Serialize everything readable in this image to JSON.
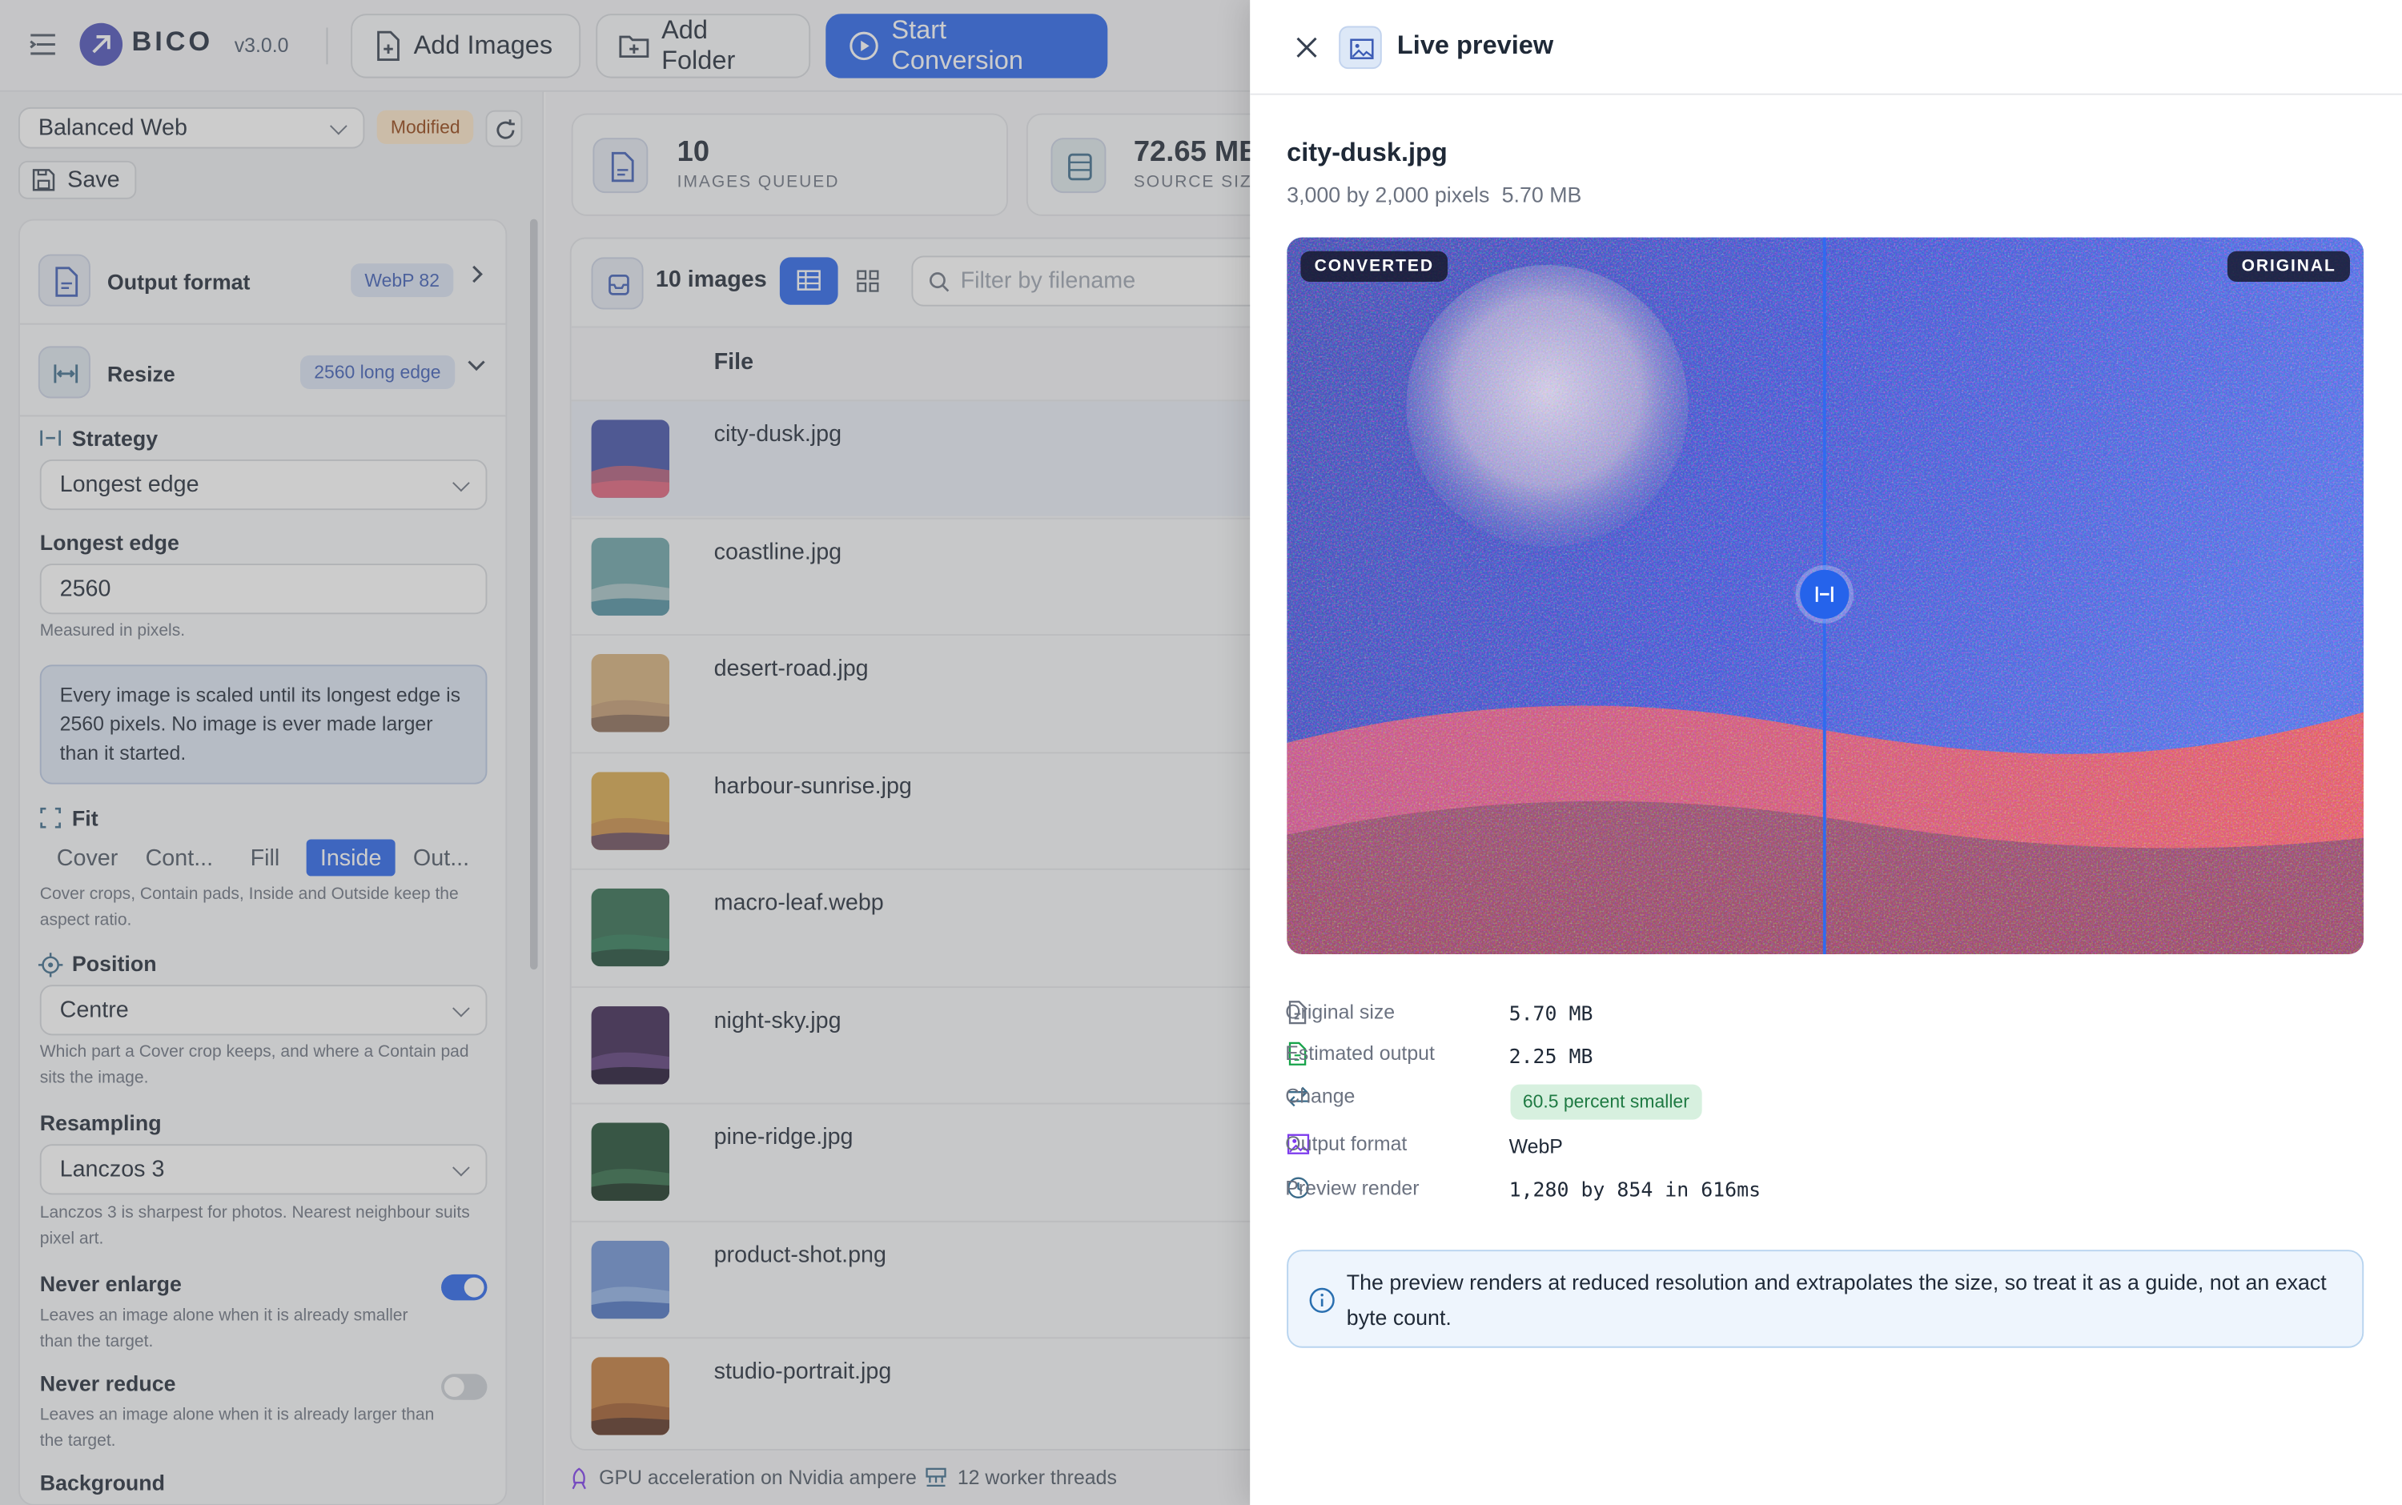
{
  "app": {
    "name": "BICO",
    "version": "v3.0.0"
  },
  "toolbar": {
    "add_images": "Add Images",
    "add_folder": "Add Folder",
    "start": "Start Conversion"
  },
  "preset": {
    "name": "Balanced Web",
    "badge": "Modified",
    "save": "Save"
  },
  "sections": {
    "output_format": {
      "title": "Output format",
      "badge": "WebP 82"
    },
    "resize": {
      "title": "Resize",
      "badge": "2560 long edge"
    }
  },
  "resize": {
    "strategy_label": "Strategy",
    "strategy_value": "Longest edge",
    "edge_label": "Longest edge",
    "edge_value": "2560",
    "edge_help": "Measured in pixels.",
    "info": "Every image is scaled until its longest edge is 2560 pixels. No image is ever made larger than it started.",
    "fit_label": "Fit",
    "fit_options": [
      "Cover",
      "Cont...",
      "Fill",
      "Inside",
      "Out..."
    ],
    "fit_selected": "Inside",
    "fit_help": "Cover crops, Contain pads, Inside and Outside keep the aspect ratio.",
    "position_label": "Position",
    "position_value": "Centre",
    "position_help": "Which part a Cover crop keeps, and where a Contain pad sits the image.",
    "resampling_label": "Resampling",
    "resampling_value": "Lanczos 3",
    "resampling_help": "Lanczos 3 is sharpest for photos. Nearest neighbour suits pixel art.",
    "never_enlarge_label": "Never enlarge",
    "never_enlarge_on": true,
    "never_enlarge_help": "Leaves an image alone when it is already smaller than the target.",
    "never_reduce_label": "Never reduce",
    "never_reduce_on": false,
    "never_reduce_help": "Leaves an image alone when it is already larger than the target.",
    "background_label": "Background"
  },
  "stats": [
    {
      "value": "10",
      "label": "IMAGES QUEUED"
    },
    {
      "value": "72.65 MB",
      "label": "SOURCE SIZE"
    }
  ],
  "list": {
    "count": "10 images",
    "filter_placeholder": "Filter by filename",
    "column_file": "File",
    "files": [
      "city-dusk.jpg",
      "coastline.jpg",
      "desert-road.jpg",
      "harbour-sunrise.jpg",
      "macro-leaf.webp",
      "night-sky.jpg",
      "pine-ridge.jpg",
      "product-shot.png",
      "studio-portrait.jpg"
    ]
  },
  "status": {
    "gpu": "GPU acceleration on Nvidia ampere",
    "threads": "12 worker threads"
  },
  "drawer": {
    "title": "Live preview",
    "file": "city-dusk.jpg",
    "dims": "3,000 by 2,000 pixels",
    "size": "5.70 MB",
    "tag_left": "CONVERTED",
    "tag_right": "ORIGINAL",
    "compare_split": 0.5,
    "metrics": [
      {
        "label": "Original size",
        "value": "5.70 MB"
      },
      {
        "label": "Estimated output",
        "value": "2.25 MB"
      },
      {
        "label": "Change",
        "value": "60.5 percent smaller"
      },
      {
        "label": "Output format",
        "value": "WebP"
      },
      {
        "label": "Preview render",
        "value": "1,280 by 854 in 616ms"
      }
    ],
    "notice": "The preview renders at reduced resolution and extrapolates the size, so treat it as a guide, not an exact byte count."
  },
  "colors": {
    "accent": "#2563eb",
    "success_bg": "#d7f0df",
    "success_text": "#1f7a43"
  }
}
